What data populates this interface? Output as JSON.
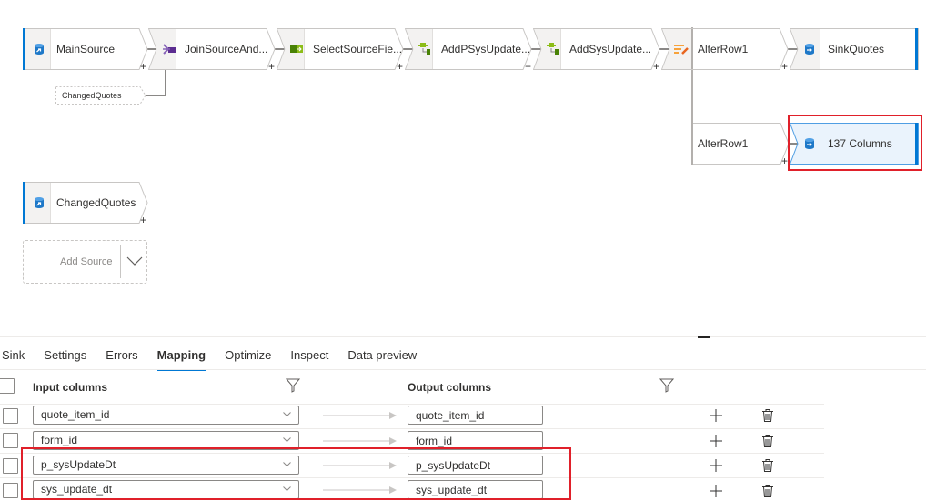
{
  "canvas": {
    "nodes": [
      {
        "id": "main-source",
        "label": "MainSource",
        "type": "source",
        "icon": "source-database-icon"
      },
      {
        "id": "join",
        "label": "JoinSourceAnd...",
        "type": "join",
        "icon": "join-icon"
      },
      {
        "id": "select",
        "label": "SelectSourceFie...",
        "type": "select",
        "icon": "select-icon"
      },
      {
        "id": "derived1",
        "label": "AddPSysUpdate...",
        "type": "derived-column",
        "icon": "derived-column-icon"
      },
      {
        "id": "derived2",
        "label": "AddSysUpdate...",
        "type": "derived-column",
        "icon": "derived-column-icon"
      },
      {
        "id": "alter-row",
        "label": "AlterRow1",
        "type": "alter-row",
        "icon": "alter-row-icon"
      },
      {
        "id": "sink-quotes",
        "label": "SinkQuotes",
        "type": "sink",
        "icon": "sink-database-icon"
      },
      {
        "id": "alter-row-branch",
        "label": "AlterRow1",
        "type": "branch-reference"
      },
      {
        "id": "sink-columns",
        "label": "137 Columns",
        "type": "sink",
        "icon": "sink-database-icon",
        "selected": true
      },
      {
        "id": "changed-quotes",
        "label": "ChangedQuotes",
        "type": "source",
        "icon": "source-database-icon"
      }
    ],
    "join_reference": "ChangedQuotes",
    "add_source_label": "Add Source",
    "plus_symbol": "+"
  },
  "panel": {
    "tabs": [
      {
        "label": "Sink",
        "active": false
      },
      {
        "label": "Settings",
        "active": false
      },
      {
        "label": "Errors",
        "active": false
      },
      {
        "label": "Mapping",
        "active": true
      },
      {
        "label": "Optimize",
        "active": false
      },
      {
        "label": "Inspect",
        "active": false
      },
      {
        "label": "Data preview",
        "active": false
      }
    ],
    "mapping": {
      "input_header": "Input columns",
      "output_header": "Output columns",
      "rows": [
        {
          "input": "quote_item_id",
          "output": "quote_item_id",
          "highlighted": false
        },
        {
          "input": "form_id",
          "output": "form_id",
          "highlighted": false
        },
        {
          "input": "p_sysUpdateDt",
          "output": "p_sysUpdateDt",
          "highlighted": true
        },
        {
          "input": "sys_update_dt",
          "output": "sys_update_dt",
          "highlighted": true
        }
      ]
    }
  },
  "colors": {
    "accent": "#0078d4",
    "highlight_box": "#e0202a",
    "selected_node_bg": "#eaf3fc",
    "connector": "#8a8886"
  }
}
